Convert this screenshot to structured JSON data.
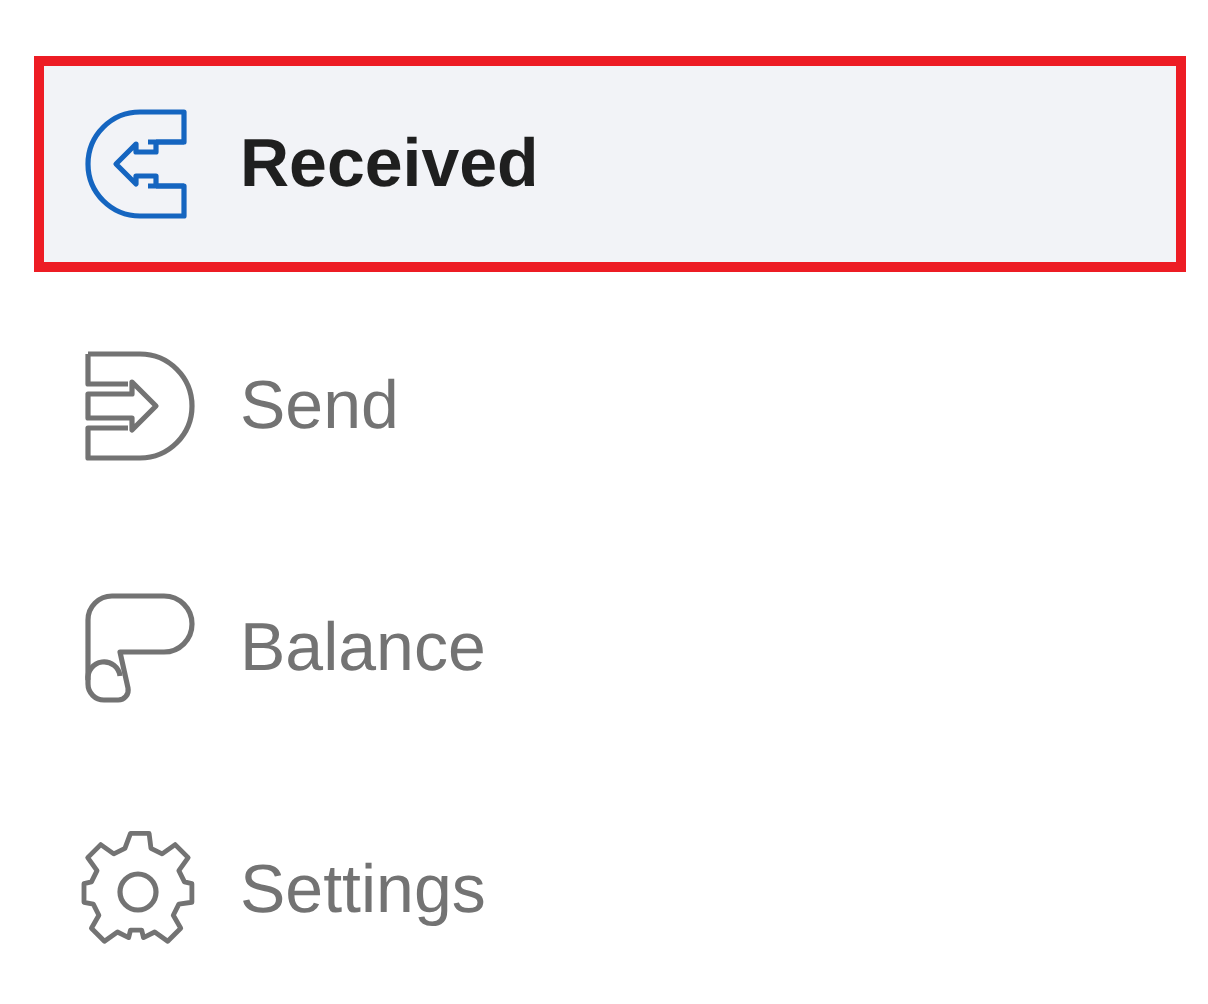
{
  "menu": {
    "items": [
      {
        "kind": "received",
        "label": "Received",
        "selected": true
      },
      {
        "kind": "send",
        "label": "Send",
        "selected": false
      },
      {
        "kind": "balance",
        "label": "Balance",
        "selected": false
      },
      {
        "kind": "settings",
        "label": "Settings",
        "selected": false
      }
    ]
  }
}
